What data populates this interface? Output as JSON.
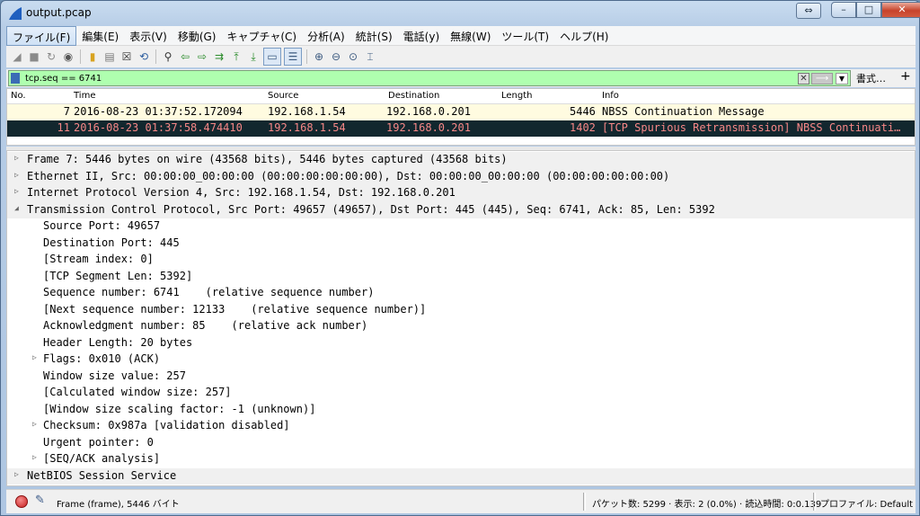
{
  "window": {
    "title": "output.pcap"
  },
  "menu": [
    "ファイル(F)",
    "編集(E)",
    "表示(V)",
    "移動(G)",
    "キャプチャ(C)",
    "分析(A)",
    "統計(S)",
    "電話(y)",
    "無線(W)",
    "ツール(T)",
    "ヘルプ(H)"
  ],
  "toolbar_icons": [
    "shark-fin-start-icon",
    "stop-icon",
    "restart-icon",
    "options-icon",
    "open-icon",
    "save-icon",
    "close-file-icon",
    "reload-icon",
    "find-icon",
    "back-icon",
    "forward-icon",
    "goto-icon",
    "first-icon",
    "last-icon",
    "autoscroll-icon",
    "colorize-icon",
    "zoom-in-icon",
    "zoom-out-icon",
    "zoom-normal-icon",
    "resize-columns-icon"
  ],
  "filter": {
    "value": "tcp.seq == 6741",
    "expression_label": "書式…",
    "plus_label": "+"
  },
  "packet_list": {
    "columns": [
      "No.",
      "Time",
      "Source",
      "Destination",
      "Length",
      "Info"
    ],
    "rows": [
      {
        "no": "7",
        "time": "2016-08-23 01:37:52.172094",
        "source": "192.168.1.54",
        "destination": "192.168.0.201",
        "length": "5446",
        "info": "NBSS Continuation Message"
      },
      {
        "no": "11",
        "time": "2016-08-23 01:37:58.474410",
        "source": "192.168.1.54",
        "destination": "192.168.0.201",
        "length": "1402",
        "info": "[TCP Spurious Retransmission] NBSS Continuati…"
      }
    ]
  },
  "details": [
    {
      "text": "Frame 7: 5446 bytes on wire (43568 bits), 5446 bytes captured (43568 bits)",
      "arrow": "▷",
      "level": 0
    },
    {
      "text": "Ethernet II, Src: 00:00:00_00:00:00 (00:00:00:00:00:00), Dst: 00:00:00_00:00:00 (00:00:00:00:00:00)",
      "arrow": "▷",
      "level": 0
    },
    {
      "text": "Internet Protocol Version 4, Src: 192.168.1.54, Dst: 192.168.0.201",
      "arrow": "▷",
      "level": 0
    },
    {
      "text": "Transmission Control Protocol, Src Port: 49657 (49657), Dst Port: 445 (445), Seq: 6741, Ack: 85, Len: 5392",
      "arrow": "◢",
      "level": 0
    },
    {
      "text": "Source Port: 49657",
      "arrow": "",
      "level": 1
    },
    {
      "text": "Destination Port: 445",
      "arrow": "",
      "level": 1
    },
    {
      "text": "[Stream index: 0]",
      "arrow": "",
      "level": 1
    },
    {
      "text": "[TCP Segment Len: 5392]",
      "arrow": "",
      "level": 1
    },
    {
      "text": "Sequence number: 6741    (relative sequence number)",
      "arrow": "",
      "level": 1
    },
    {
      "text": "[Next sequence number: 12133    (relative sequence number)]",
      "arrow": "",
      "level": 1
    },
    {
      "text": "Acknowledgment number: 85    (relative ack number)",
      "arrow": "",
      "level": 1
    },
    {
      "text": "Header Length: 20 bytes",
      "arrow": "",
      "level": 1
    },
    {
      "text": "Flags: 0x010 (ACK)",
      "arrow": "▷",
      "level": 1
    },
    {
      "text": "Window size value: 257",
      "arrow": "",
      "level": 1
    },
    {
      "text": "[Calculated window size: 257]",
      "arrow": "",
      "level": 1
    },
    {
      "text": "[Window size scaling factor: -1 (unknown)]",
      "arrow": "",
      "level": 1
    },
    {
      "text": "Checksum: 0x987a [validation disabled]",
      "arrow": "▷",
      "level": 1
    },
    {
      "text": "Urgent pointer: 0",
      "arrow": "",
      "level": 1
    },
    {
      "text": "[SEQ/ACK analysis]",
      "arrow": "▷",
      "level": 1
    },
    {
      "text": "NetBIOS Session Service",
      "arrow": "▷",
      "level": 0
    }
  ],
  "status": {
    "left": "Frame (frame), 5446 バイト",
    "middle": "パケット数: 5299 · 表示: 2 (0.0%) · 読込時間: 0:0.139",
    "right": "プロファイル: Default"
  },
  "colors": {
    "filter_ok": "#afffaf",
    "selected_row_bg": "#12272e",
    "selected_row_fg": "#f78787",
    "row_bg": "#fffbe0"
  }
}
